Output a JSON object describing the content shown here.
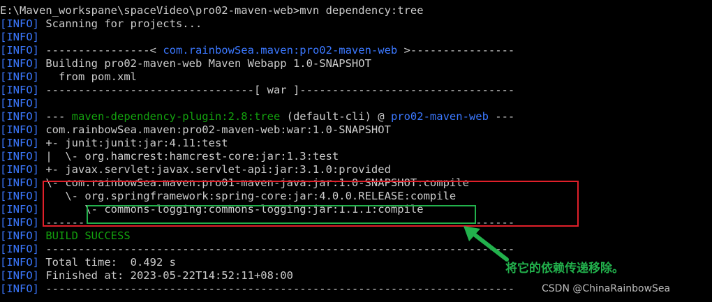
{
  "colors": {
    "background": "#000000",
    "text": "#cccccc",
    "info_tag": "#3b78ff",
    "highlight_blue": "#3b78ff",
    "highlight_green": "#13a10e",
    "red_box": "#e0202a",
    "green_box": "#22b14c"
  },
  "prompt": "E:\\Maven_workspane\\spaceVideo\\pro02-maven-web>mvn dependency:tree",
  "tag": "[INFO]",
  "lines": [
    {
      "t": " Scanning for projects..."
    },
    {
      "t": ""
    },
    {
      "a": " ----------------< ",
      "b": "com.rainbowSea.maven:pro02-maven-web",
      "c": " >----------------"
    },
    {
      "t": " Building pro02-maven-web Maven Webapp 1.0-SNAPSHOT"
    },
    {
      "t": "   from pom.xml"
    },
    {
      "t": " --------------------------------[ war ]---------------------------------"
    },
    {
      "t": ""
    },
    {
      "a": " --- ",
      "g": "maven-dependency-plugin:2.8:tree",
      "m": " (default-cli) @ ",
      "b": "pro02-maven-web",
      "c": " ---"
    },
    {
      "t": " com.rainbowSea.maven:pro02-maven-web:war:1.0-SNAPSHOT"
    },
    {
      "t": " +- junit:junit:jar:4.11:test"
    },
    {
      "t": " |  \\- org.hamcrest:hamcrest-core:jar:1.3:test"
    },
    {
      "t": " +- javax.servlet:javax.servlet-api:jar:3.1.0:provided"
    },
    {
      "t": " \\- com.rainbowSea.maven:pro01-maven-java:jar:1.0-SNAPSHOT:compile"
    },
    {
      "t": "    \\- org.springframework:spring-core:jar:4.0.0.RELEASE:compile"
    },
    {
      "t": "       \\- commons-logging:commons-logging:jar:1.1.1:compile"
    },
    {
      "t": " ------------------------------------------------------------------------"
    },
    {
      "g": " BUILD SUCCESS"
    },
    {
      "t": " ------------------------------------------------------------------------"
    },
    {
      "t": " Total time:  0.492 s"
    },
    {
      "t": " Finished at: 2023-05-22T14:52:11+08:00"
    },
    {
      "t": " ------------------------------------------------------------------------"
    }
  ],
  "annotation": "将它的依赖传递移除。",
  "watermark": "CSDN @ChinaRainbowSea"
}
